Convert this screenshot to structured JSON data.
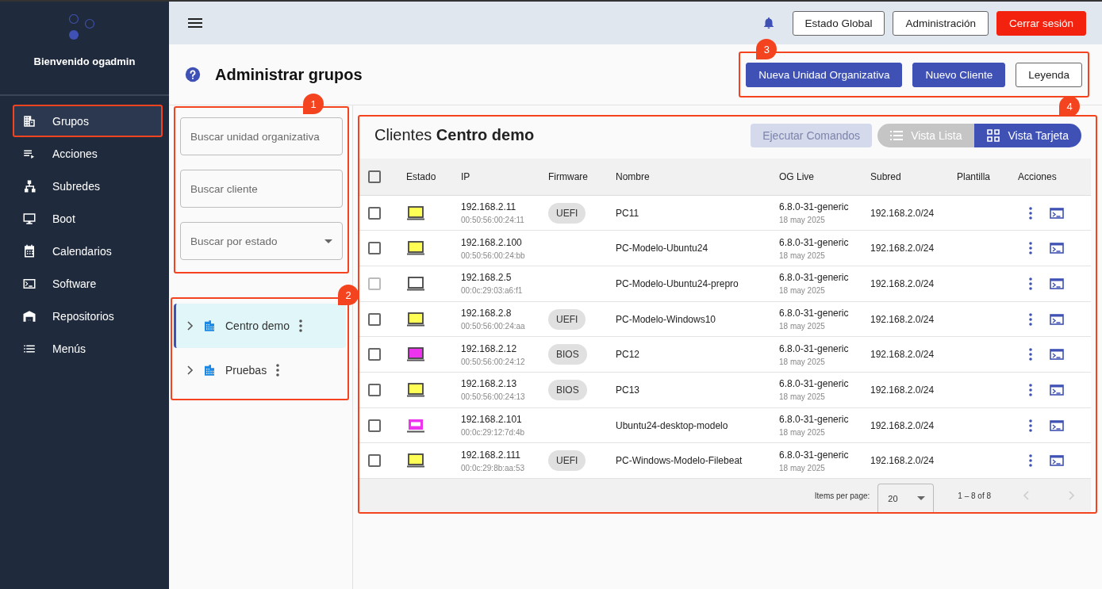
{
  "sidebar": {
    "welcome": "Bienvenido ogadmin",
    "items": [
      {
        "label": "Grupos",
        "selected": true,
        "highlighted": true
      },
      {
        "label": "Acciones",
        "selected": false,
        "highlighted": false
      },
      {
        "label": "Subredes",
        "selected": false,
        "highlighted": false
      },
      {
        "label": "Boot",
        "selected": false,
        "highlighted": false
      },
      {
        "label": "Calendarios",
        "selected": false,
        "highlighted": false
      },
      {
        "label": "Software",
        "selected": false,
        "highlighted": false
      },
      {
        "label": "Repositorios",
        "selected": false,
        "highlighted": false
      },
      {
        "label": "Menús",
        "selected": false,
        "highlighted": false
      }
    ]
  },
  "topbar": {
    "buttons": [
      {
        "label": "Estado Global",
        "kind": "outline"
      },
      {
        "label": "Administración",
        "kind": "outline"
      },
      {
        "label": "Cerrar sesión",
        "kind": "danger"
      }
    ]
  },
  "page": {
    "title": "Administrar grupos",
    "callout": "3",
    "buttons": [
      {
        "label": "Nueva Unidad Organizativa",
        "kind": "primary"
      },
      {
        "label": "Nuevo Cliente",
        "kind": "primary"
      },
      {
        "label": "Leyenda",
        "kind": "outline"
      }
    ]
  },
  "filters": {
    "callout": "1",
    "fields": [
      {
        "placeholder": "Buscar unidad organizativa",
        "kind": "text"
      },
      {
        "placeholder": "Buscar cliente",
        "kind": "text"
      },
      {
        "placeholder": "Buscar por estado",
        "kind": "select"
      }
    ]
  },
  "tree": {
    "callout": "2",
    "items": [
      {
        "label": "Centro demo",
        "selected": true
      },
      {
        "label": "Pruebas",
        "selected": false
      }
    ]
  },
  "clients": {
    "callout": "4",
    "title_prefix": "Clientes",
    "title_unit": "Centro demo",
    "run_button": {
      "label": "Ejecutar Comandos",
      "disabled": true
    },
    "views": [
      {
        "label": "Vista Lista",
        "selected": false
      },
      {
        "label": "Vista Tarjeta",
        "selected": true
      }
    ],
    "columns": [
      "Estado",
      "IP",
      "Firmware",
      "Nombre",
      "OG Live",
      "Subred",
      "Plantilla",
      "Acciones"
    ],
    "header_checked": false,
    "rows": [
      {
        "checked": false,
        "disabled": false,
        "color": "#ffff55",
        "kind": "filled",
        "ip": "192.168.2.11",
        "mac": "00:50:56:00:24:11",
        "firmware": "UEFI",
        "name": "PC11",
        "oglive": "6.8.0-31-generic",
        "date": "18 may 2025",
        "subnet": "192.168.2.0/24"
      },
      {
        "checked": false,
        "disabled": false,
        "color": "#ffff55",
        "kind": "filled",
        "ip": "192.168.2.100",
        "mac": "00:50:56:00:24:bb",
        "name": "PC-Modelo-Ubuntu24",
        "oglive": "6.8.0-31-generic",
        "date": "18 may 2025",
        "subnet": "192.168.2.0/24"
      },
      {
        "checked": false,
        "disabled": true,
        "color": "#ffffff",
        "kind": "filled",
        "ip": "192.168.2.5",
        "mac": "00:0c:29:03:a6:f1",
        "name": "PC-Modelo-Ubuntu24-prepro",
        "oglive": "6.8.0-31-generic",
        "date": "18 may 2025",
        "subnet": "192.168.2.0/24"
      },
      {
        "checked": false,
        "disabled": false,
        "color": "#ffff55",
        "kind": "filled",
        "ip": "192.168.2.8",
        "mac": "00:50:56:00:24:aa",
        "firmware": "UEFI",
        "name": "PC-Modelo-Windows10",
        "oglive": "6.8.0-31-generic",
        "date": "18 may 2025",
        "subnet": "192.168.2.0/24"
      },
      {
        "checked": false,
        "disabled": false,
        "color": "#ee33ee",
        "kind": "filled",
        "ip": "192.168.2.12",
        "mac": "00:50:56:00:24:12",
        "firmware": "BIOS",
        "name": "PC12",
        "oglive": "6.8.0-31-generic",
        "date": "18 may 2025",
        "subnet": "192.168.2.0/24"
      },
      {
        "checked": false,
        "disabled": false,
        "color": "#ffff55",
        "kind": "filled",
        "ip": "192.168.2.13",
        "mac": "00:50:56:00:24:13",
        "firmware": "BIOS",
        "name": "PC13",
        "oglive": "6.8.0-31-generic",
        "date": "18 may 2025",
        "subnet": "192.168.2.0/24"
      },
      {
        "checked": false,
        "disabled": false,
        "color": "#ee33ee",
        "kind": "bordered",
        "ip": "192.168.2.101",
        "mac": "00:0c:29:12:7d:4b",
        "name": "Ubuntu24-desktop-modelo",
        "oglive": "6.8.0-31-generic",
        "date": "18 may 2025",
        "subnet": "192.168.2.0/24"
      },
      {
        "checked": false,
        "disabled": false,
        "color": "#ffff55",
        "kind": "filled",
        "ip": "192.168.2.111",
        "mac": "00:0c:29:8b:aa:53",
        "firmware": "UEFI",
        "name": "PC-Windows-Modelo-Filebeat",
        "oglive": "6.8.0-31-generic",
        "date": "18 may 2025",
        "subnet": "192.168.2.0/24"
      }
    ],
    "paginator": {
      "label": "Items per page:",
      "page_size": "20",
      "range": "1 – 8 of 8"
    }
  }
}
